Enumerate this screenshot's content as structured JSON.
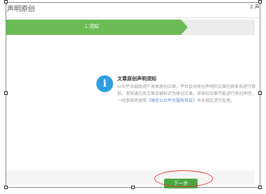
{
  "panel": {
    "title": "声明原创"
  },
  "steps": [
    {
      "label": "1 须知"
    },
    {
      "label": "2 声"
    }
  ],
  "notice": {
    "title": "文章原创声明须知",
    "body_before_link": "公众平台鼓励用户发表原创文章。平台会对原创声明的文章在群发后进行审核。审核通过后文章会被标识为原创文章。非原创文章不能进行原创声明，一经发现将按照",
    "link_text": "《微信公众平台服务协议》",
    "body_after_link": "有关规定进行处理。",
    "icon": "info-icon"
  },
  "footer": {
    "next_label": "下一步"
  },
  "colors": {
    "step_active": "#6cbc55",
    "info_icon": "#2d9ee0",
    "next_button": "#4aa641",
    "annotation_circle": "#e23a3a"
  }
}
